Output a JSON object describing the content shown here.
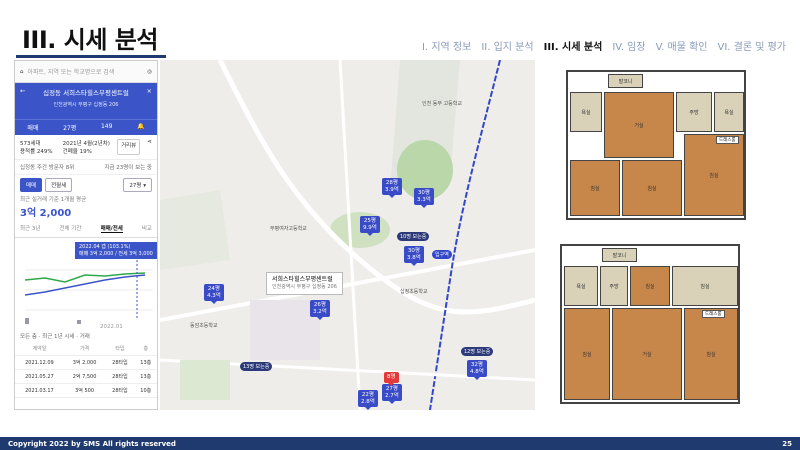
{
  "slide": {
    "title": "III. 시세 분석",
    "nav": [
      "I. 지역 정보",
      "II. 입지 분석",
      "III. 시세 분석",
      "IV. 임장",
      "V. 매물 확인",
      "VI. 결론 및 평가"
    ],
    "footer": "Copyright 2022 by SMS All rights reserved",
    "page": "25"
  },
  "app": {
    "search_placeholder": "아파트, 지역 또는 학교명으로 검색",
    "header_title": "십정동 서희스타힐스부평센트럴",
    "header_address": "인천광역시 부평구 십정동 206",
    "tabs": [
      "매매",
      "27평",
      "149"
    ],
    "info_left": [
      "573세대",
      "용적률 249%"
    ],
    "info_mid": [
      "2021년 4월(2년차)",
      "건폐율 19%"
    ],
    "distance_btn": "거리뷰",
    "row1_left": "십정동 주간 방문자 8위",
    "row1_right": "지금 23명이 보는 중",
    "trade_tabs": [
      "매매",
      "전월세"
    ],
    "area_select": "27평",
    "price_label": "최근 실거래 기준 1개월 평균",
    "price": "3억 2,000",
    "period_tabs": [
      "최근 3년",
      "전체 기간",
      "매매/전세",
      "비교"
    ],
    "tooltip_line1": "2022.04  갭 (103.1%)",
    "tooltip_line2": "매매 3억 2,000 / 전세 3억 3,000",
    "chart_x": "2022.01",
    "table_title": "모든 층 · 최근 1년 시세 · 거래",
    "table_headers": [
      "계약일",
      "가격",
      "타입",
      "층"
    ],
    "table_rows": [
      [
        "2021.12.09",
        "3억 2,000",
        "28타입",
        "13층"
      ],
      [
        "2021.05.27",
        "2억 7,500",
        "28타입",
        "13층"
      ],
      [
        "2021.03.17",
        "3억 500",
        "28타입",
        "10층"
      ]
    ]
  },
  "map": {
    "markers": [
      {
        "label": "28평",
        "price": "3.9억"
      },
      {
        "label": "30평",
        "price": "3.3억"
      },
      {
        "label": "25평",
        "price": "9.9억"
      },
      {
        "label": "30평",
        "price": "3.8억"
      },
      {
        "label": "24평",
        "price": "4.3억"
      },
      {
        "label": "26평",
        "price": "3.2억"
      },
      {
        "label": "22평",
        "price": "2.8억"
      },
      {
        "label": "27평",
        "price": "2.7억"
      },
      {
        "label": "32평",
        "price": "4.8억"
      }
    ],
    "red_marker": "8명",
    "parking": [
      "10명 보는중",
      "12명 보는중",
      "13명 보는중"
    ],
    "popup_title": "서희스타힐스부평센트럴",
    "popup_sub": "인천광역시 부평구 십정동 206",
    "subway_label": "입구역",
    "labels": [
      "인천 동부 고등학교",
      "부평여자고등학교",
      "동암초등학교",
      "십정초등학교"
    ]
  },
  "floorplans": {
    "rooms": [
      "침실",
      "거실",
      "주방",
      "욕실",
      "발코니",
      "드레스룸",
      "현관"
    ]
  }
}
